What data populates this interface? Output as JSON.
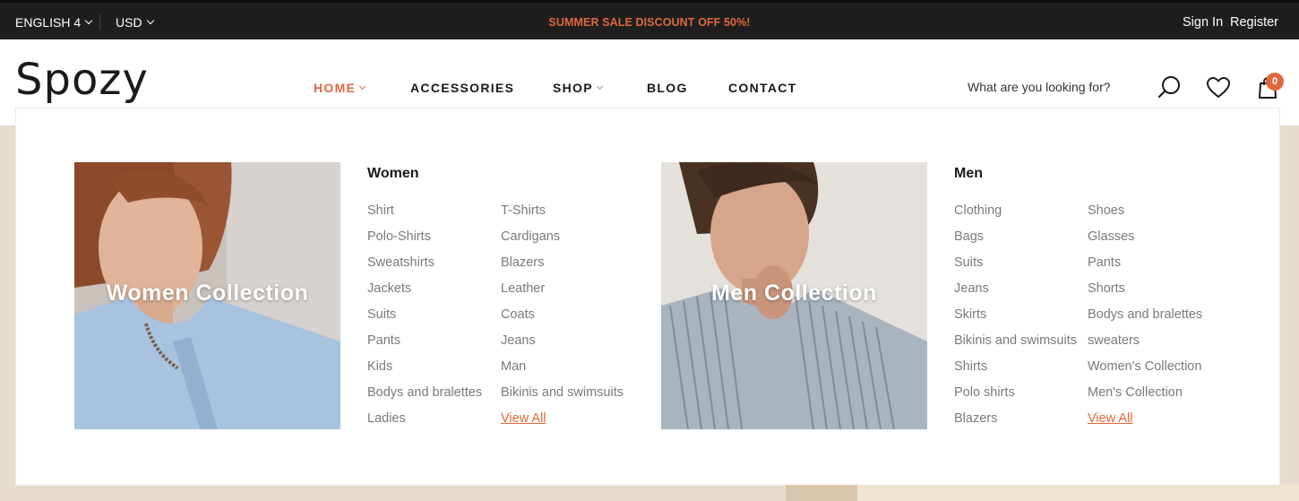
{
  "topbar": {
    "language": "ENGLISH 4",
    "currency": "USD",
    "promo": "SUMMER SALE DISCOUNT OFF 50%!",
    "sign_in": "Sign In",
    "register": "Register",
    "promo_color": "#e0683c"
  },
  "header": {
    "logo": "Spozy",
    "nav": [
      {
        "label": "HOME",
        "active": true,
        "has_dropdown": true
      },
      {
        "label": "ACCESSORIES",
        "active": false,
        "has_dropdown": false
      },
      {
        "label": "SHOP",
        "active": false,
        "has_dropdown": true
      },
      {
        "label": "BLOG",
        "active": false,
        "has_dropdown": false
      },
      {
        "label": "CONTACT",
        "active": false,
        "has_dropdown": false
      }
    ],
    "search_placeholder": "What are you looking for?",
    "icons": [
      "search-icon",
      "heart-icon",
      "shopping-bag-icon"
    ],
    "cart_count": "0"
  },
  "mega_menu": {
    "women": {
      "image_title": "Women Collection",
      "heading": "Women",
      "col1": [
        "Shirt",
        "Polo-Shirts",
        "Sweatshirts",
        "Jackets",
        "Suits",
        "Pants",
        "Kids",
        "Bodys and bralettes",
        "Ladies"
      ],
      "col2": [
        "T-Shirts",
        "Cardigans",
        "Blazers",
        "Leather",
        "Coats",
        "Jeans",
        "Man",
        "Bikinis and swimsuits"
      ],
      "view_all": "View All"
    },
    "men": {
      "image_title": "Men Collection",
      "heading": "Men",
      "col1": [
        "Clothing",
        "Bags",
        "Suits",
        "Jeans",
        "Skirts",
        "Bikinis and swimsuits",
        "Shirts",
        "Polo shirts",
        "Blazers"
      ],
      "col2": [
        "Shoes",
        "Glasses",
        "Pants",
        "Shorts",
        "Bodys and bralettes",
        "sweaters",
        "Women's Collection",
        "Men's Collection"
      ],
      "view_all": "View All"
    }
  },
  "colors": {
    "accent": "#e0683c",
    "topbar_bg": "#1e1e1e",
    "page_bg": "#e6dccd"
  }
}
